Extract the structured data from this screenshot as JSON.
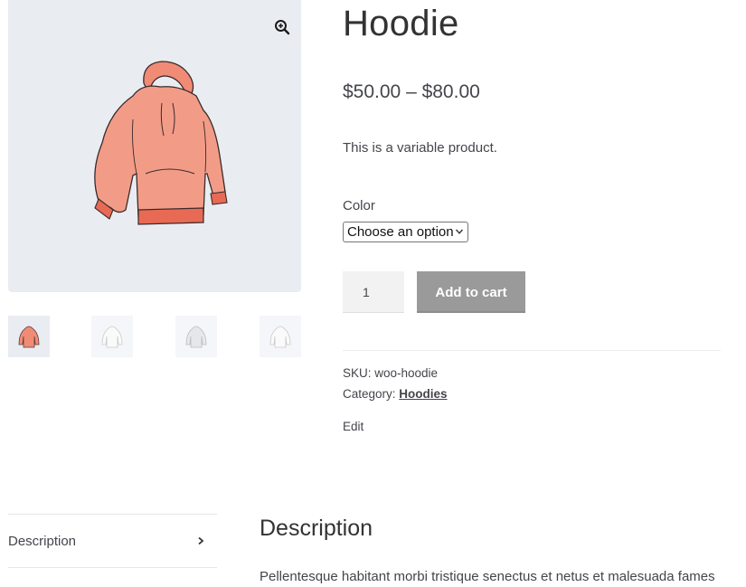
{
  "product": {
    "title": "Hoodie",
    "price": "$50.00 – $80.00",
    "short_description": "This is a variable product.",
    "color_label": "Color",
    "color_select_value": "Choose an option",
    "quantity": "1",
    "add_to_cart_label": "Add to cart",
    "sku_text": "SKU: woo-hoodie",
    "category_prefix": "Category:",
    "category_link": "Hoodies",
    "edit_label": "Edit"
  },
  "gallery": {
    "thumbnails": [
      "hoodie-thumb",
      "hoodie-thumb",
      "hoodie-thumb",
      "hoodie-thumb"
    ],
    "zoom_icon": "zoom-in-icon"
  },
  "tabs": {
    "items": [
      {
        "label": "Description"
      }
    ]
  },
  "description": {
    "heading": "Description",
    "body": "Pellentesque habitant morbi tristique senectus et netus et malesuada fames"
  },
  "colors": {
    "hoodie": "#f08b76",
    "hoodie_dark": "#e06a55",
    "gallery_bg": "#e9edf2",
    "button_bg": "#9a9a9a"
  }
}
